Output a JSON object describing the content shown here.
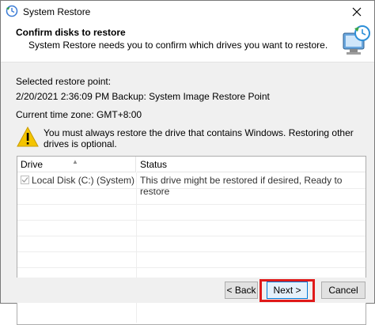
{
  "window": {
    "title": "System Restore",
    "icon": "system-restore-icon"
  },
  "header": {
    "title": "Confirm disks to restore",
    "subtitle": "System Restore needs you to confirm which drives you want to restore."
  },
  "body": {
    "selected_label": "Selected restore point:",
    "restore_point": "2/20/2021 2:36:09 PM Backup: System Image Restore Point",
    "timezone": "Current time zone: GMT+8:00",
    "warning": "You must always restore the drive that contains Windows. Restoring other drives is optional."
  },
  "table": {
    "columns": [
      "Drive",
      "Status"
    ],
    "rows": [
      {
        "checked": true,
        "drive": "Local Disk (C:) (System)",
        "status": "This drive might be restored if desired, Ready to restore"
      }
    ]
  },
  "buttons": {
    "back": "< Back",
    "next": "Next >",
    "cancel": "Cancel"
  },
  "colors": {
    "highlight": "#e01a1a",
    "warning": "#f4c400",
    "dialog_bg": "#f0f0f0"
  }
}
